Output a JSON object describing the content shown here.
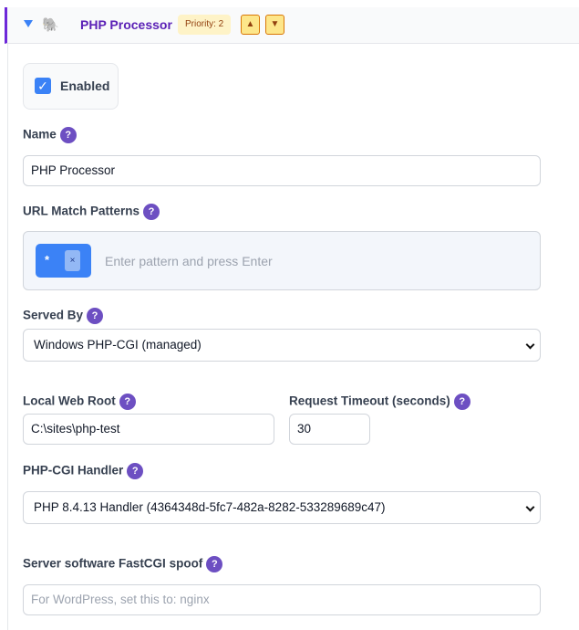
{
  "header": {
    "title": "PHP Processor",
    "priority": "Priority: 2",
    "move_up": "▲",
    "move_down": "▼",
    "icon": "elephant-icon"
  },
  "enabled": {
    "label": "Enabled",
    "checked": true
  },
  "help_glyph": "?",
  "fields": {
    "name": {
      "label": "Name",
      "value": "PHP Processor"
    },
    "url_patterns": {
      "label": "URL Match Patterns",
      "tags": [
        "*"
      ],
      "remove_glyph": "×",
      "placeholder": "Enter pattern and press Enter"
    },
    "served_by": {
      "label": "Served By",
      "value": "Windows PHP-CGI (managed)"
    },
    "web_root": {
      "label": "Local Web Root",
      "value": "C:\\sites\\php-test"
    },
    "timeout": {
      "label": "Request Timeout (seconds)",
      "value": "30"
    },
    "handler": {
      "label": "PHP-CGI Handler",
      "value": "PHP 8.4.13 Handler (4364348d-5fc7-482a-8282-533289689c47)"
    },
    "fastcgi_spoof": {
      "label": "Server software FastCGI spoof",
      "value": "",
      "placeholder": "For WordPress, set this to: nginx"
    }
  },
  "colors": {
    "accent": "#3b82f6",
    "brand": "#5b21b6",
    "help": "#6d4fc2"
  }
}
